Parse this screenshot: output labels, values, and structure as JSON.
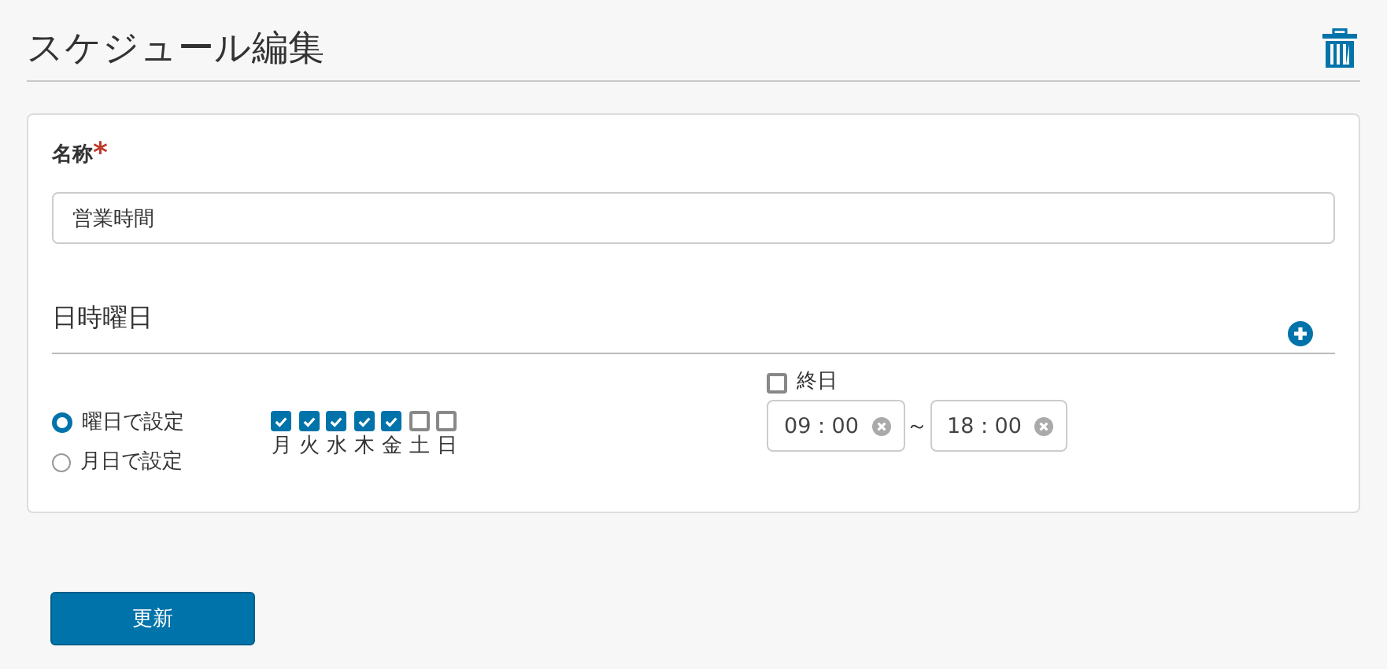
{
  "page": {
    "title": "スケジュール編集"
  },
  "name_field": {
    "label": "名称",
    "required_mark": "*",
    "value": "営業時間"
  },
  "section": {
    "title": "日時曜日"
  },
  "modes": [
    {
      "label": "曜日で設定",
      "selected": true
    },
    {
      "label": "月日で設定",
      "selected": false
    }
  ],
  "weekdays": [
    {
      "label": "月",
      "checked": true
    },
    {
      "label": "火",
      "checked": true
    },
    {
      "label": "水",
      "checked": true
    },
    {
      "label": "木",
      "checked": true
    },
    {
      "label": "金",
      "checked": true
    },
    {
      "label": "土",
      "checked": false
    },
    {
      "label": "日",
      "checked": false
    }
  ],
  "all_day": {
    "label": "終日",
    "checked": false
  },
  "time_range": {
    "start": "09 : 00",
    "separator": "～",
    "end": "18 : 00"
  },
  "submit": {
    "label": "更新"
  }
}
